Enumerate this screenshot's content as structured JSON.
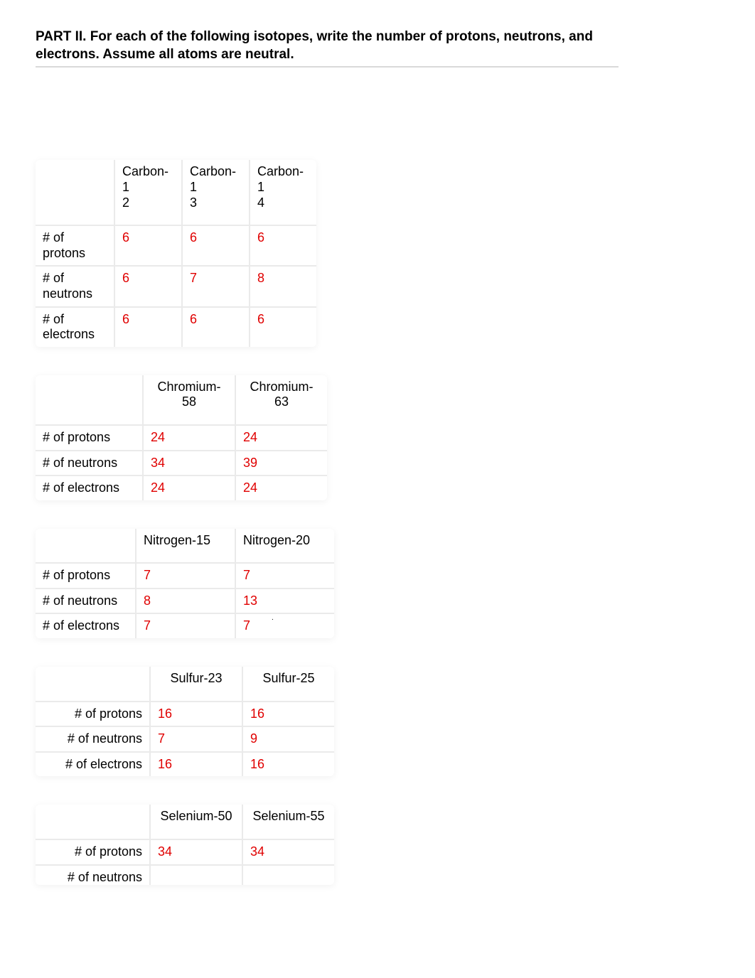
{
  "header": "PART II.  For each of the following isotopes, write the number of protons, neutrons, and electrons.  Assume all atoms are neutral.",
  "rowLabels": {
    "protons": "# of protons",
    "neutrons": "# of neutrons",
    "electrons": "# of electrons",
    "protons_wrap": "# of\nprotons",
    "neutrons_wrap": "# of\nneutrons",
    "electrons_wrap": "# of\nelectrons"
  },
  "table1": {
    "cols": [
      "Carbon-1\n2",
      "Carbon-1\n3",
      "Carbon-1\n4"
    ],
    "protons": [
      "6",
      "6",
      "6"
    ],
    "neutrons": [
      "6",
      "7",
      "8"
    ],
    "electrons": [
      "6",
      "6",
      "6"
    ]
  },
  "table2": {
    "cols": [
      "Chromium-58",
      "Chromium-63"
    ],
    "protons": [
      "24",
      "24"
    ],
    "neutrons": [
      "34",
      "39"
    ],
    "electrons": [
      "24",
      "24"
    ]
  },
  "table3": {
    "cols": [
      "Nitrogen-15",
      "Nitrogen-20"
    ],
    "protons": [
      "7",
      "7"
    ],
    "neutrons": [
      "8",
      "13"
    ],
    "electrons": [
      "7",
      "7"
    ]
  },
  "table4": {
    "cols": [
      "Sulfur-23",
      "Sulfur-25"
    ],
    "protons": [
      "16",
      "16"
    ],
    "neutrons": [
      "7",
      "9"
    ],
    "electrons": [
      "16",
      "16"
    ]
  },
  "table5": {
    "cols": [
      "Selenium-50",
      "Selenium-55"
    ],
    "protons": [
      "34",
      "34"
    ],
    "neutrons": [
      "",
      ""
    ],
    "electrons_visible": false
  }
}
